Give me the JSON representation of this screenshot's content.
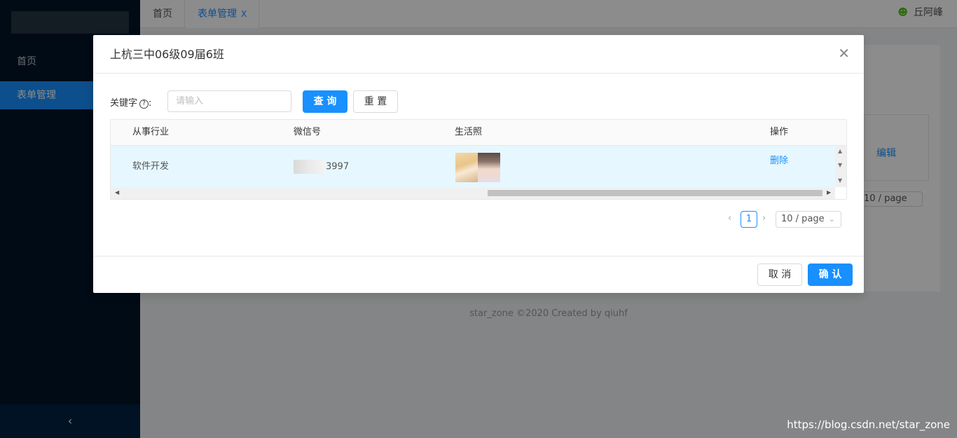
{
  "sidebar": {
    "items": [
      {
        "label": "首页"
      },
      {
        "label": "表单管理"
      }
    ]
  },
  "topbar": {
    "tabs": [
      {
        "label": "首页"
      },
      {
        "label": "表单管理",
        "close": "X"
      }
    ],
    "user_name": "丘阿峰"
  },
  "background": {
    "table_action": "编辑",
    "page_size": "10 / page",
    "footer": "star_zone ©2020 Created by qiuhf",
    "watermark": "https://blog.csdn.net/star_zone"
  },
  "modal": {
    "title": "上杭三中06级09届6班",
    "close_icon": "close-icon",
    "search": {
      "label": "关键字",
      "placeholder": "请输入",
      "query_button": "查 询",
      "reset_button": "重 置"
    },
    "table": {
      "columns": [
        "从事行业",
        "微信号",
        "生活照",
        "操作"
      ],
      "rows": [
        {
          "industry": "软件开发",
          "wechat_suffix": "3997",
          "action": "删除"
        }
      ]
    },
    "pagination": {
      "current_page": "1",
      "page_size": "10 / page"
    },
    "footer": {
      "cancel_button": "取 消",
      "ok_button": "确 认"
    }
  },
  "colors": {
    "primary": "#1890ff",
    "sidebar_bg": "#001529",
    "row_highlight": "#e6f7ff"
  }
}
